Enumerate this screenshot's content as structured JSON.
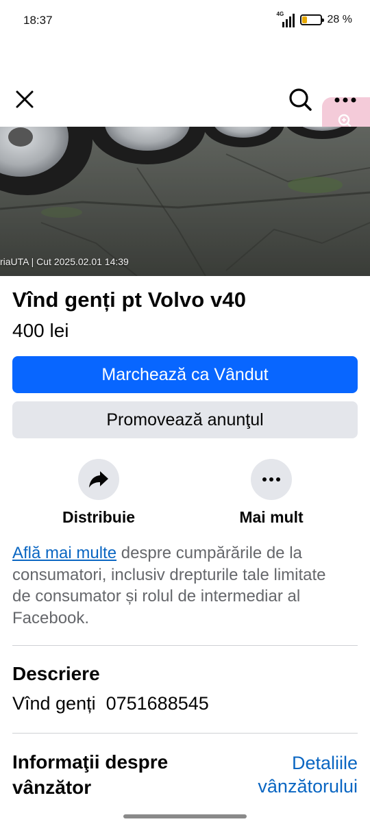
{
  "status_bar": {
    "time": "18:37",
    "network": "4G",
    "battery_percent_text": "28 %",
    "battery_level": 0.28
  },
  "top_bar": {
    "icons": [
      "close-icon",
      "search-icon",
      "more-horizontal-icon",
      "zoom-icon"
    ]
  },
  "photo": {
    "caption": "riaUTA  |  Cut  2025.02.01 14:39"
  },
  "listing": {
    "title": "Vînd genți pt Volvo v40",
    "price": "400 lei"
  },
  "buttons": {
    "mark_sold": "Marchează ca Vândut",
    "promote": "Promovează anunţul"
  },
  "actions": {
    "share_label": "Distribuie",
    "more_label": "Mai mult"
  },
  "info": {
    "link_text": "Află mai multe",
    "rest_text": " despre cumpărările de la consumatori, inclusiv drepturile tale limitate de consumator și rolul de intermediar al Facebook."
  },
  "description": {
    "title": "Descriere",
    "text": "Vînd genți  0751688545"
  },
  "seller": {
    "title": "Informaţii despre vânzător",
    "details_link": "Detaliile vânzătorului"
  },
  "colors": {
    "primary": "#0866ff",
    "secondary_button": "#e4e6eb",
    "link": "#0a66c2",
    "muted_text": "#65676b"
  }
}
